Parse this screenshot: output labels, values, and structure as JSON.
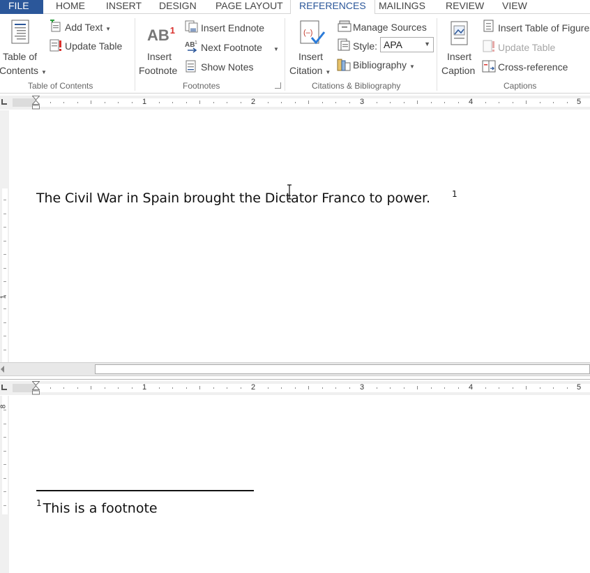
{
  "tabs": [
    "FILE",
    "HOME",
    "INSERT",
    "DESIGN",
    "PAGE LAYOUT",
    "REFERENCES",
    "MAILINGS",
    "REVIEW",
    "VIEW"
  ],
  "active_tab": "REFERENCES",
  "ribbon": {
    "toc": {
      "table_of_contents_line1": "Table of",
      "table_of_contents_line2": "Contents",
      "add_text": "Add Text",
      "update_table": "Update Table",
      "group_label": "Table of Contents"
    },
    "footnotes": {
      "insert_footnote_line1": "Insert",
      "insert_footnote_line2": "Footnote",
      "insert_endnote": "Insert Endnote",
      "next_footnote": "Next Footnote",
      "show_notes": "Show Notes",
      "group_label": "Footnotes",
      "icon_text": "AB",
      "icon_superscript": "1"
    },
    "citations": {
      "insert_citation_line1": "Insert",
      "insert_citation_line2": "Citation",
      "manage_sources": "Manage Sources",
      "style_label": "Style:",
      "style_value": "APA",
      "bibliography": "Bibliography",
      "group_label": "Citations & Bibliography"
    },
    "captions": {
      "insert_caption_line1": "Insert",
      "insert_caption_line2": "Caption",
      "insert_table_of_figures": "Insert Table of Figures",
      "update_table": "Update Table",
      "cross_reference": "Cross-reference",
      "group_label": "Captions"
    }
  },
  "ruler": {
    "numbers": [
      "1",
      "2",
      "3",
      "4",
      "5"
    ]
  },
  "vruler": {
    "top_number": "1",
    "bottom_number": "8"
  },
  "document": {
    "body_text": "The Civil War in Spain brought the Dictator Franco to power.",
    "footnote_ref": "1",
    "footnote_number": "1",
    "footnote_text": "This is a footnote"
  },
  "colors": {
    "accent": "#2b579a",
    "citation_red": "#c0392b",
    "check_blue": "#2b7bd8"
  }
}
